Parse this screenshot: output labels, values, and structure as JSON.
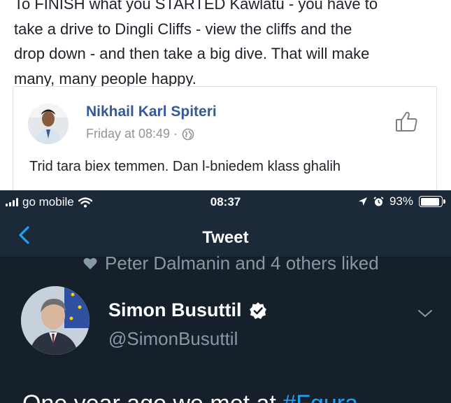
{
  "facebook": {
    "post_lines": [
      "To FINISH what you STARTED Kawlatu - you have to",
      "take a drive to Dingli Cliffs - view the cliffs and the",
      "drop down - and then take a big dive. That will make",
      "many, many people happy."
    ],
    "reply": {
      "author": "Nikhail Karl Spiteri",
      "time": "Friday at 08:49 ·",
      "privacy_icon": "globe-icon",
      "like_icon": "thumbs-up-icon",
      "text": "Trid tara biex temmen. Dan l-bniedem klass ghalih"
    }
  },
  "twitter": {
    "status_bar": {
      "carrier": "go mobile",
      "time": "08:37",
      "battery": "93%",
      "battery_level": 0.93
    },
    "nav": {
      "title": "Tweet",
      "back_icon": "chevron-left-icon"
    },
    "liked_by": "Peter Dalmanin and 4 others liked",
    "tweet": {
      "author": "Simon Busuttil",
      "handle": "@SimonBusuttil",
      "text_prefix": "One year ago we met at ",
      "hashtag": "#Fgura"
    },
    "colors": {
      "background": "#15202b",
      "bar": "#1c2938",
      "accent": "#1da1f2",
      "muted": "#8899a6"
    }
  }
}
